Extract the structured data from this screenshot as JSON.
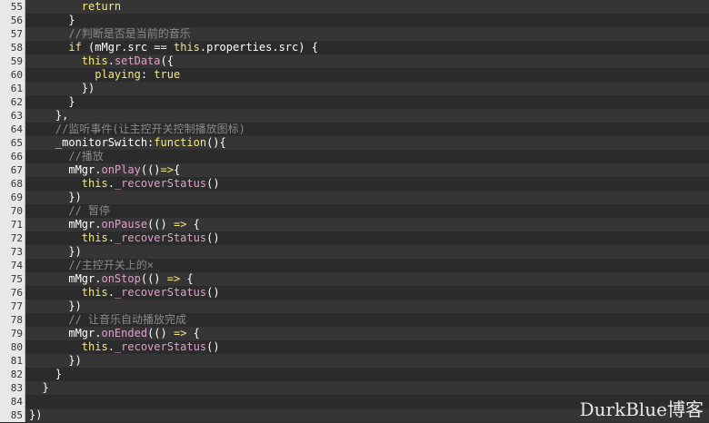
{
  "lines": [
    {
      "n": "55",
      "tokens": [
        {
          "t": "        ",
          "c": "plain"
        },
        {
          "t": "return",
          "c": "kw"
        }
      ]
    },
    {
      "n": "56",
      "tokens": [
        {
          "t": "      }",
          "c": "punc"
        }
      ]
    },
    {
      "n": "57",
      "tokens": [
        {
          "t": "      ",
          "c": "plain"
        },
        {
          "t": "//判断是否是当前的音乐",
          "c": "cm"
        }
      ]
    },
    {
      "n": "58",
      "tokens": [
        {
          "t": "      ",
          "c": "plain"
        },
        {
          "t": "if",
          "c": "kw"
        },
        {
          "t": " (mMgr.src == ",
          "c": "plain"
        },
        {
          "t": "this",
          "c": "kw"
        },
        {
          "t": ".properties.src) {",
          "c": "plain"
        }
      ]
    },
    {
      "n": "59",
      "tokens": [
        {
          "t": "        ",
          "c": "plain"
        },
        {
          "t": "this",
          "c": "kw"
        },
        {
          "t": ".",
          "c": "plain"
        },
        {
          "t": "setData",
          "c": "fn"
        },
        {
          "t": "({",
          "c": "plain"
        }
      ]
    },
    {
      "n": "60",
      "tokens": [
        {
          "t": "          playing",
          "c": "prop"
        },
        {
          "t": ": ",
          "c": "plain"
        },
        {
          "t": "true",
          "c": "bool"
        }
      ]
    },
    {
      "n": "61",
      "tokens": [
        {
          "t": "        })",
          "c": "punc"
        }
      ]
    },
    {
      "n": "62",
      "tokens": [
        {
          "t": "      }",
          "c": "punc"
        }
      ]
    },
    {
      "n": "63",
      "tokens": [
        {
          "t": "    },",
          "c": "punc"
        }
      ]
    },
    {
      "n": "64",
      "tokens": [
        {
          "t": "    ",
          "c": "plain"
        },
        {
          "t": "//监听事件(让主控开关控制播放图标)",
          "c": "cm"
        }
      ]
    },
    {
      "n": "65",
      "tokens": [
        {
          "t": "    _monitorSwitch",
          "c": "plain"
        },
        {
          "t": ":",
          "c": "plain"
        },
        {
          "t": "function",
          "c": "kw"
        },
        {
          "t": "(){",
          "c": "plain"
        }
      ]
    },
    {
      "n": "66",
      "tokens": [
        {
          "t": "      ",
          "c": "plain"
        },
        {
          "t": "//播放",
          "c": "cm"
        }
      ]
    },
    {
      "n": "67",
      "tokens": [
        {
          "t": "      mMgr.",
          "c": "plain"
        },
        {
          "t": "onPlay",
          "c": "fn"
        },
        {
          "t": "(()",
          "c": "plain"
        },
        {
          "t": "=>",
          "c": "kw"
        },
        {
          "t": "{",
          "c": "plain"
        }
      ]
    },
    {
      "n": "68",
      "tokens": [
        {
          "t": "        ",
          "c": "plain"
        },
        {
          "t": "this",
          "c": "kw"
        },
        {
          "t": ".",
          "c": "plain"
        },
        {
          "t": "_recoverStatus",
          "c": "fn"
        },
        {
          "t": "()",
          "c": "plain"
        }
      ]
    },
    {
      "n": "69",
      "tokens": [
        {
          "t": "      })",
          "c": "punc"
        }
      ]
    },
    {
      "n": "70",
      "tokens": [
        {
          "t": "      ",
          "c": "plain"
        },
        {
          "t": "// 暂停",
          "c": "cm"
        }
      ]
    },
    {
      "n": "71",
      "tokens": [
        {
          "t": "      mMgr.",
          "c": "plain"
        },
        {
          "t": "onPause",
          "c": "fn"
        },
        {
          "t": "(() ",
          "c": "plain"
        },
        {
          "t": "=>",
          "c": "kw"
        },
        {
          "t": " {",
          "c": "plain"
        }
      ]
    },
    {
      "n": "72",
      "tokens": [
        {
          "t": "        ",
          "c": "plain"
        },
        {
          "t": "this",
          "c": "kw"
        },
        {
          "t": ".",
          "c": "plain"
        },
        {
          "t": "_recoverStatus",
          "c": "fn"
        },
        {
          "t": "()",
          "c": "plain"
        }
      ]
    },
    {
      "n": "73",
      "tokens": [
        {
          "t": "      })",
          "c": "punc"
        }
      ]
    },
    {
      "n": "74",
      "tokens": [
        {
          "t": "      ",
          "c": "plain"
        },
        {
          "t": "//主控开关上的×",
          "c": "cm"
        }
      ]
    },
    {
      "n": "75",
      "tokens": [
        {
          "t": "      mMgr.",
          "c": "plain"
        },
        {
          "t": "onStop",
          "c": "fn"
        },
        {
          "t": "(() ",
          "c": "plain"
        },
        {
          "t": "=>",
          "c": "kw"
        },
        {
          "t": " {",
          "c": "plain"
        }
      ]
    },
    {
      "n": "76",
      "tokens": [
        {
          "t": "        ",
          "c": "plain"
        },
        {
          "t": "this",
          "c": "kw"
        },
        {
          "t": ".",
          "c": "plain"
        },
        {
          "t": "_recoverStatus",
          "c": "fn"
        },
        {
          "t": "()",
          "c": "plain"
        }
      ]
    },
    {
      "n": "77",
      "tokens": [
        {
          "t": "      })",
          "c": "punc"
        }
      ]
    },
    {
      "n": "78",
      "tokens": [
        {
          "t": "      ",
          "c": "plain"
        },
        {
          "t": "// 让音乐自动播放完成",
          "c": "cm"
        }
      ]
    },
    {
      "n": "79",
      "tokens": [
        {
          "t": "      mMgr.",
          "c": "plain"
        },
        {
          "t": "onEnded",
          "c": "fn"
        },
        {
          "t": "(() ",
          "c": "plain"
        },
        {
          "t": "=>",
          "c": "kw"
        },
        {
          "t": " {",
          "c": "plain"
        }
      ]
    },
    {
      "n": "80",
      "tokens": [
        {
          "t": "        ",
          "c": "plain"
        },
        {
          "t": "this",
          "c": "kw"
        },
        {
          "t": ".",
          "c": "plain"
        },
        {
          "t": "_recoverStatus",
          "c": "fn"
        },
        {
          "t": "()",
          "c": "plain"
        }
      ]
    },
    {
      "n": "81",
      "tokens": [
        {
          "t": "      })",
          "c": "punc"
        }
      ]
    },
    {
      "n": "82",
      "tokens": [
        {
          "t": "    }",
          "c": "punc"
        }
      ]
    },
    {
      "n": "83",
      "tokens": [
        {
          "t": "  }",
          "c": "punc"
        }
      ]
    },
    {
      "n": "84",
      "tokens": []
    },
    {
      "n": "85",
      "tokens": [
        {
          "t": "})",
          "c": "punc"
        }
      ]
    }
  ],
  "watermark": "DurkBlue博客"
}
